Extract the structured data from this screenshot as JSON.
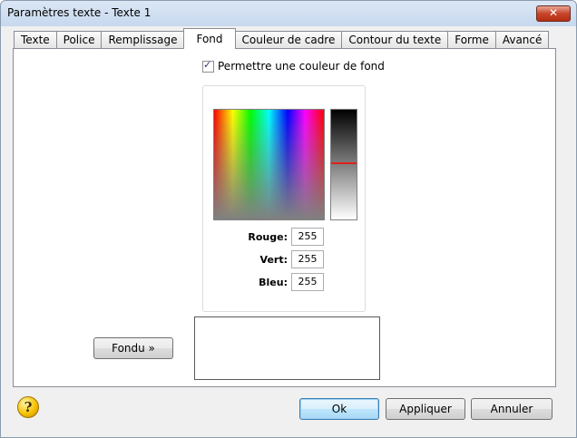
{
  "window": {
    "title": "Paramètres texte - Texte 1",
    "close_label": "✕"
  },
  "tabs": [
    {
      "label": "Texte"
    },
    {
      "label": "Police"
    },
    {
      "label": "Remplissage"
    },
    {
      "label": "Fond",
      "active": true
    },
    {
      "label": "Couleur de cadre"
    },
    {
      "label": "Contour du texte"
    },
    {
      "label": "Forme"
    },
    {
      "label": "Avancé"
    }
  ],
  "background": {
    "enable_label": "Permettre une couleur de fond",
    "enable_checked": true
  },
  "color": {
    "red_label": "Rouge:",
    "red_value": "255",
    "green_label": "Vert:",
    "green_value": "255",
    "blue_label": "Bleu:",
    "blue_value": "255"
  },
  "gradient_button": "Fondu »",
  "footer": {
    "ok": "Ok",
    "apply": "Appliquer",
    "cancel": "Annuler",
    "help_icon": "help-icon"
  }
}
